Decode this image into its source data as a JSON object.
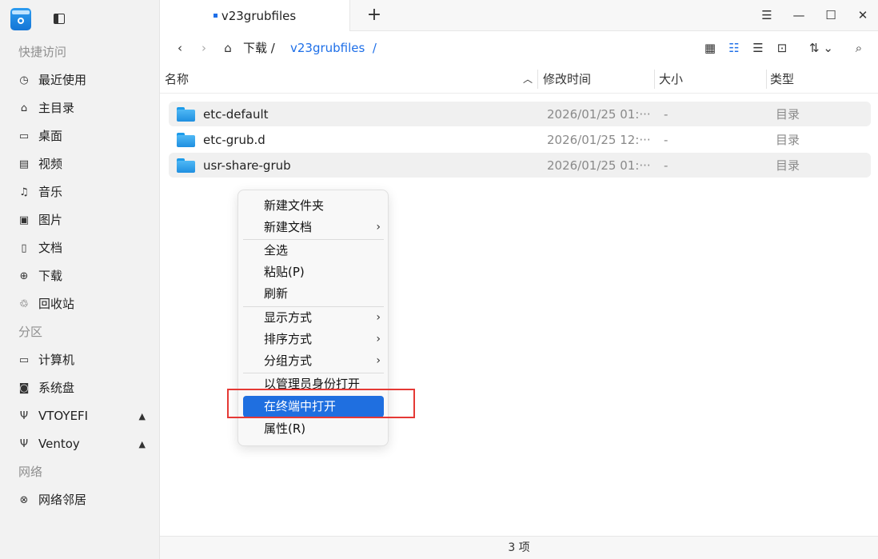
{
  "window": {
    "tab_title": "v23grubfiles"
  },
  "sidebar": {
    "sections": [
      {
        "label": "快捷访问",
        "items": [
          {
            "label": "最近使用",
            "icon": "clock-icon"
          },
          {
            "label": "主目录",
            "icon": "home-icon"
          },
          {
            "label": "桌面",
            "icon": "desktop-icon"
          },
          {
            "label": "视频",
            "icon": "video-icon"
          },
          {
            "label": "音乐",
            "icon": "music-icon"
          },
          {
            "label": "图片",
            "icon": "picture-icon"
          },
          {
            "label": "文档",
            "icon": "document-icon"
          },
          {
            "label": "下载",
            "icon": "download-icon"
          },
          {
            "label": "回收站",
            "icon": "trash-icon"
          }
        ]
      },
      {
        "label": "分区",
        "items": [
          {
            "label": "计算机",
            "icon": "computer-icon"
          },
          {
            "label": "系统盘",
            "icon": "disk-icon"
          },
          {
            "label": "VTOYEFI",
            "icon": "usb-icon"
          },
          {
            "label": "Ventoy",
            "icon": "usb-icon"
          }
        ]
      },
      {
        "label": "网络",
        "items": [
          {
            "label": "网络邻居",
            "icon": "network-icon"
          }
        ]
      }
    ]
  },
  "toolbar": {
    "breadcrumb": [
      "下载",
      "v23grubfiles"
    ],
    "separator": "/"
  },
  "columns": {
    "name": "名称",
    "modified": "修改时间",
    "size": "大小",
    "type": "类型"
  },
  "files": [
    {
      "name": "etc-default",
      "modified": "2026/01/25 01:···",
      "size": "-",
      "type": "目录"
    },
    {
      "name": "etc-grub.d",
      "modified": "2026/01/25 12:···",
      "size": "-",
      "type": "目录"
    },
    {
      "name": "usr-share-grub",
      "modified": "2026/01/25 01:···",
      "size": "-",
      "type": "目录"
    }
  ],
  "status": {
    "count_text": "3 项"
  },
  "context_menu": {
    "new_folder": "新建文件夹",
    "new_document": "新建文档",
    "select_all": "全选",
    "paste": "粘贴(P)",
    "refresh": "刷新",
    "display_mode": "显示方式",
    "sort_by": "排序方式",
    "group_by": "分组方式",
    "open_as_admin": "以管理员身份打开",
    "open_in_terminal": "在终端中打开",
    "properties": "属性(R)"
  },
  "colors": {
    "accent": "#1f6fe0",
    "highlight_box": "#e53935"
  }
}
